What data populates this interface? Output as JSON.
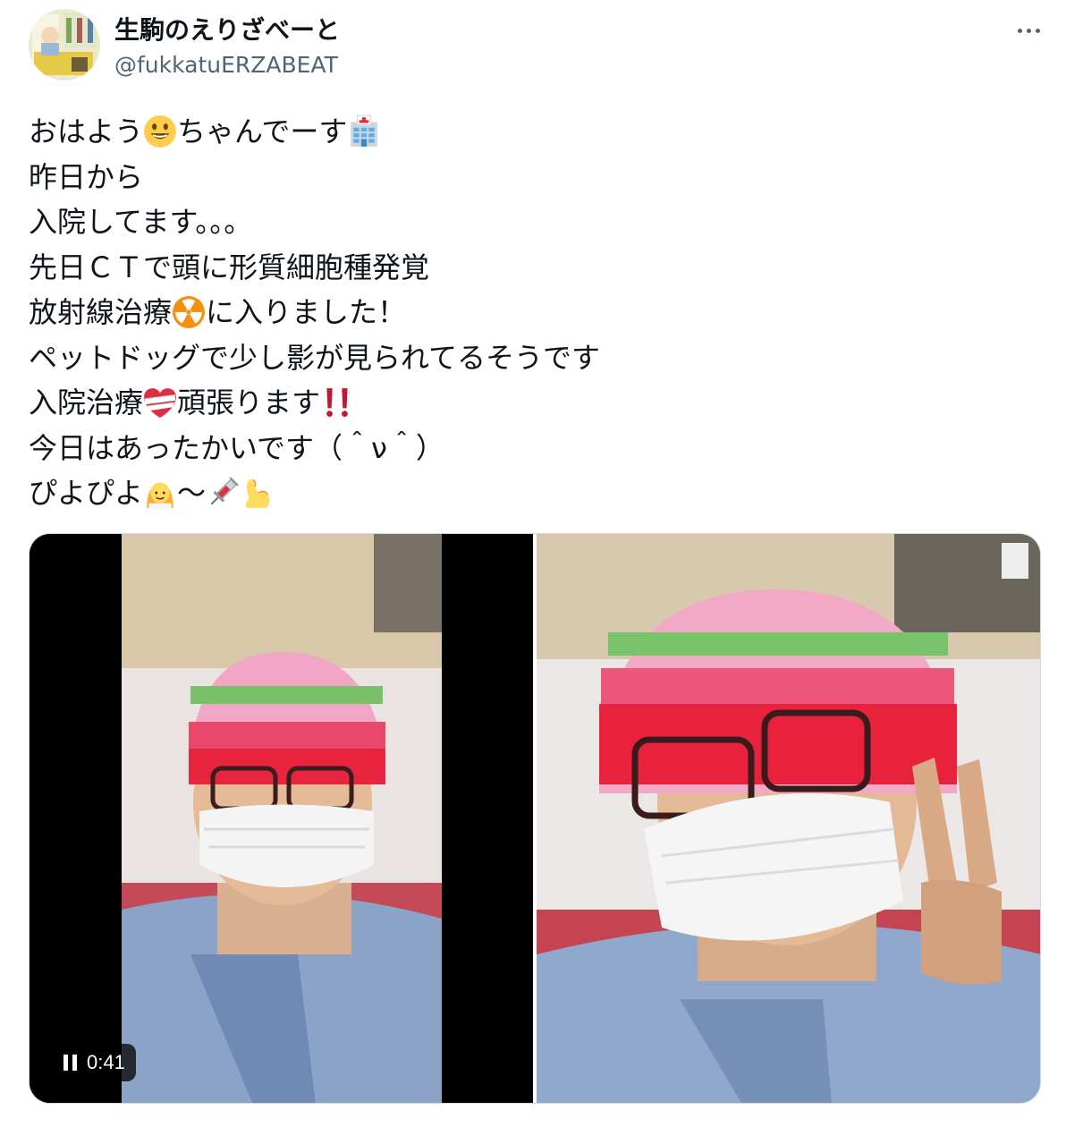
{
  "user": {
    "display_name": "生駒のえりざべーと",
    "handle": "@fukkatuERZABEAT"
  },
  "more_icon": "more-horizontal-icon",
  "lines": [
    {
      "parts": [
        {
          "t": "text",
          "v": "おはよう"
        },
        {
          "t": "emoji",
          "icon": "smiley-emoji"
        },
        {
          "t": "text",
          "v": "ちゃんでーす"
        },
        {
          "t": "emoji",
          "icon": "hospital-emoji"
        }
      ]
    },
    {
      "parts": [
        {
          "t": "text",
          "v": "昨日から"
        }
      ]
    },
    {
      "parts": [
        {
          "t": "text",
          "v": "入院してます。。。"
        }
      ]
    },
    {
      "parts": [
        {
          "t": "text",
          "v": "先日ＣＴで頭に形質細胞種発覚"
        }
      ]
    },
    {
      "parts": [
        {
          "t": "text",
          "v": "放射線治療"
        },
        {
          "t": "emoji",
          "icon": "radioactive-emoji"
        },
        {
          "t": "text",
          "v": "に入りました！"
        }
      ]
    },
    {
      "parts": [
        {
          "t": "text",
          "v": "ペットドッグで少し影が見られてるそうです"
        }
      ]
    },
    {
      "parts": [
        {
          "t": "text",
          "v": "入院治療"
        },
        {
          "t": "emoji",
          "icon": "mending-heart-emoji"
        },
        {
          "t": "text",
          "v": "頑張ります"
        },
        {
          "t": "emoji",
          "icon": "double-exclamation-emoji"
        }
      ]
    },
    {
      "parts": [
        {
          "t": "text",
          "v": "今日はあったかいです（＾ν＾）"
        }
      ]
    },
    {
      "parts": [
        {
          "t": "text",
          "v": "ぴよぴよ"
        },
        {
          "t": "emoji",
          "icon": "bride-emoji"
        },
        {
          "t": "text",
          "v": "〜"
        },
        {
          "t": "emoji",
          "icon": "syringe-emoji"
        },
        {
          "t": "emoji",
          "icon": "flexed-biceps-emoji"
        }
      ]
    }
  ],
  "video": {
    "timer": "0:41",
    "control_icon": "pause-icon"
  },
  "colors": {
    "text": "#0f1419",
    "secondary": "#536471",
    "border": "#cfd9de"
  }
}
